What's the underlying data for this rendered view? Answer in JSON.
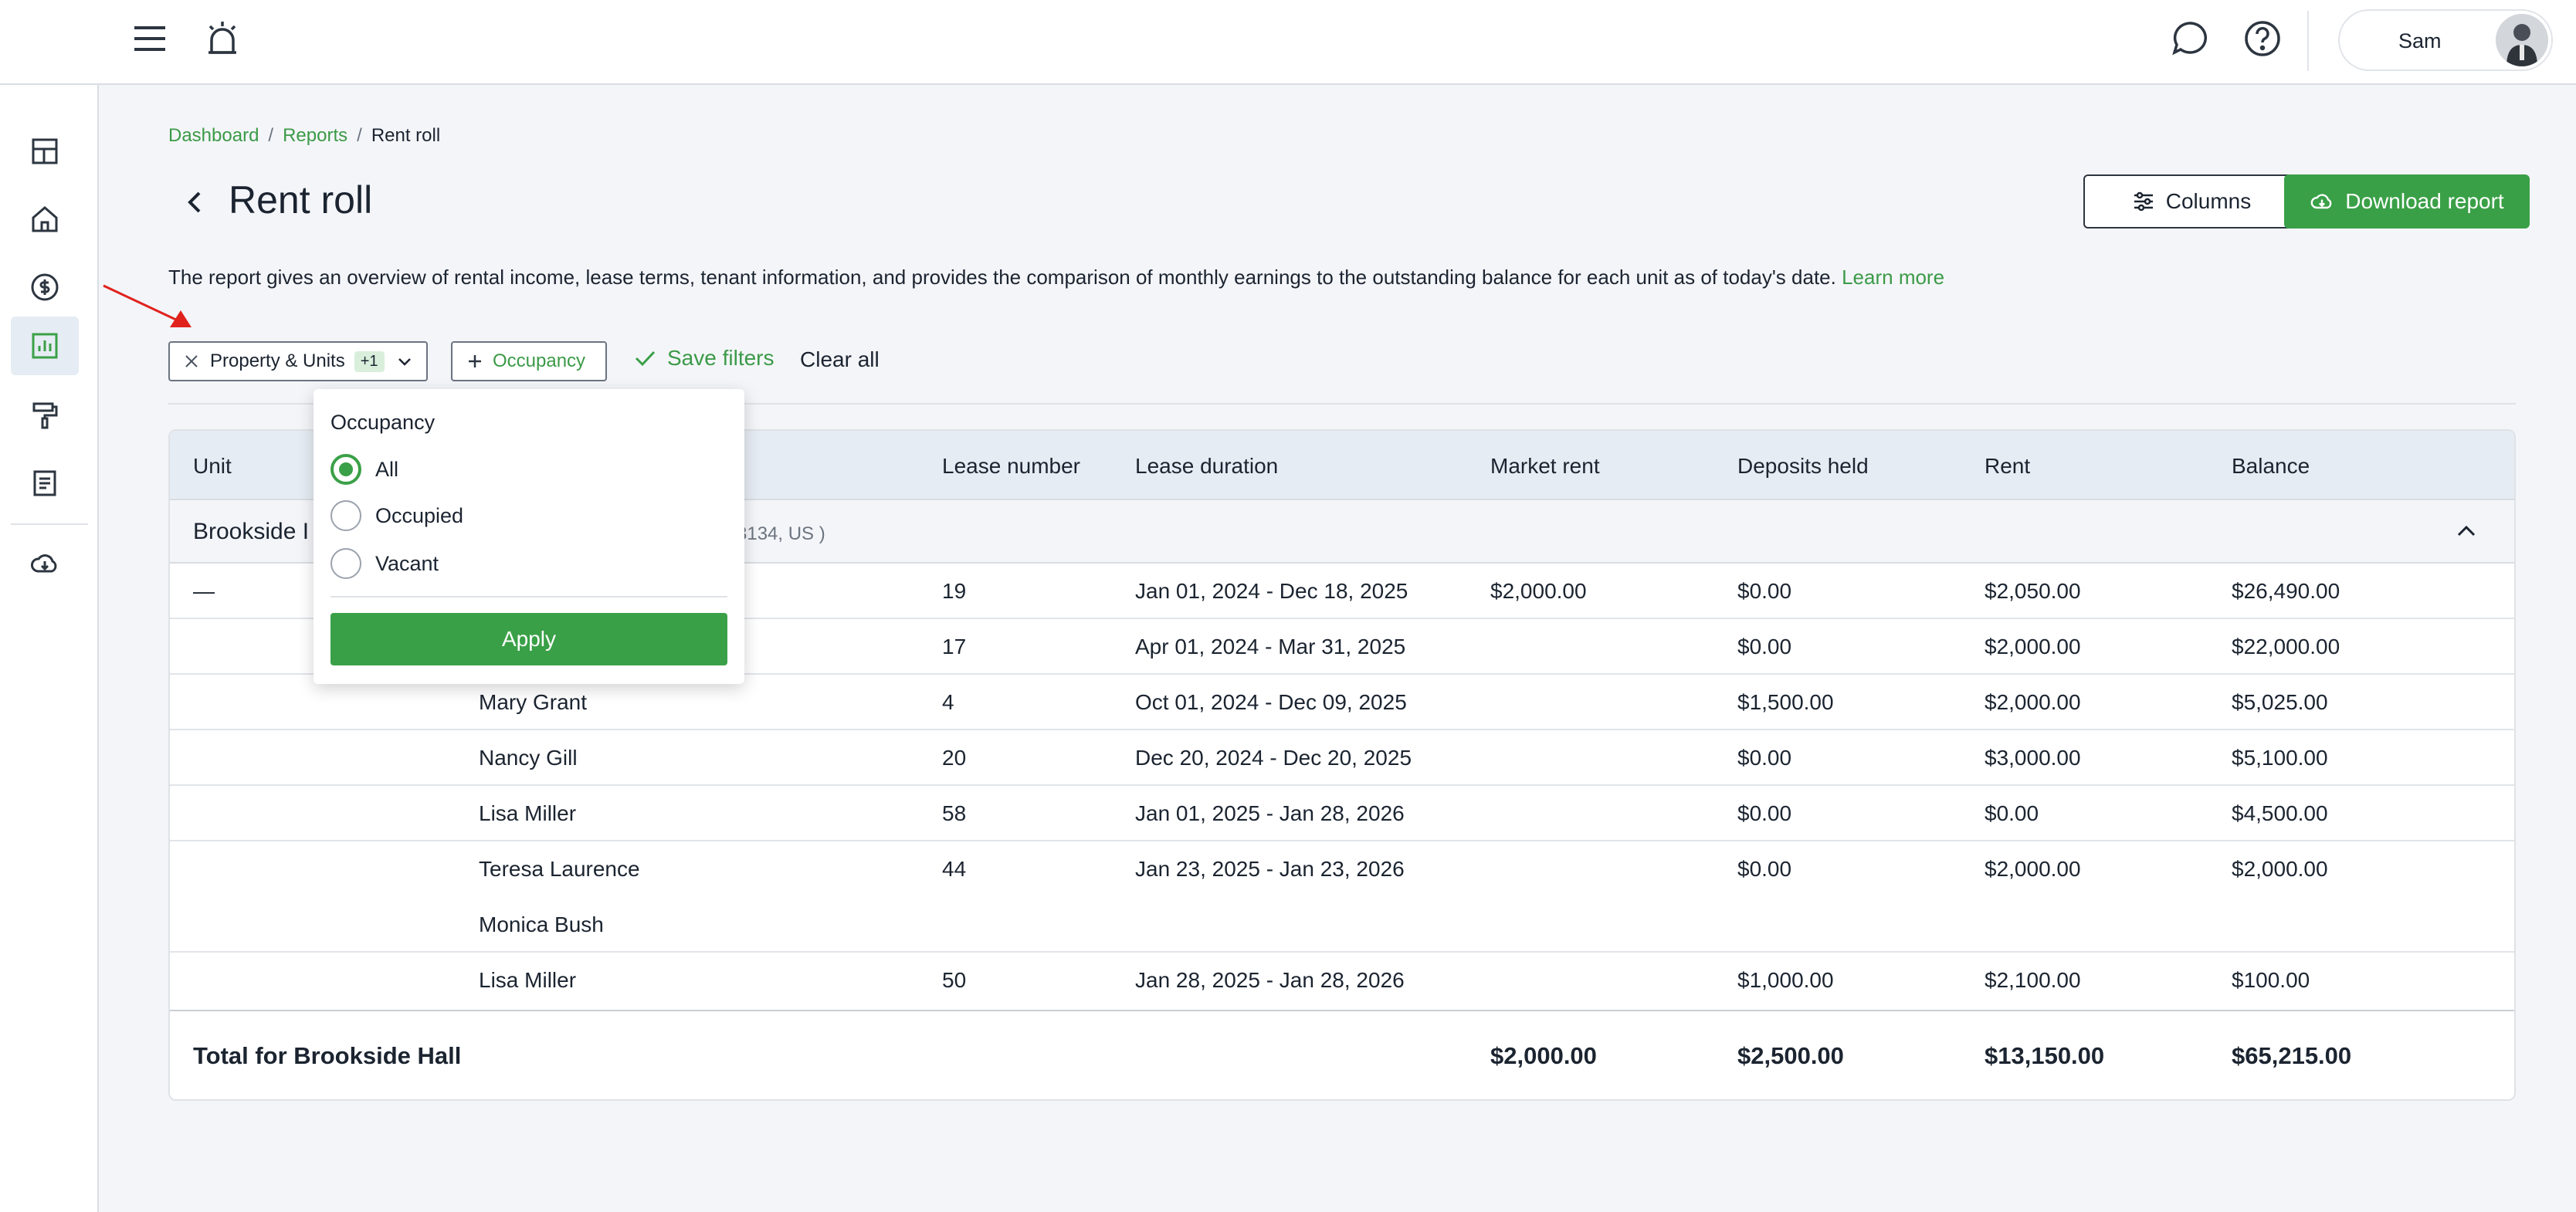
{
  "topbar": {
    "user_name": "Sam"
  },
  "breadcrumb": {
    "items": [
      "Dashboard",
      "Reports"
    ],
    "separator": "/",
    "current": "Rent roll"
  },
  "page": {
    "title": "Rent roll",
    "columns_label": "Columns",
    "download_label": "Download report",
    "description": "The report gives an overview of rental income, lease terms, tenant information, and provides the comparison of monthly earnings to the outstanding balance for each unit as of today's date.",
    "learn_more": "Learn more"
  },
  "filters": {
    "property_label": "Property & Units",
    "property_badge": "+1",
    "occupancy_label": "Occupancy",
    "save_label": "Save filters",
    "clear_label": "Clear all"
  },
  "dropdown": {
    "title": "Occupancy",
    "options": [
      "All",
      "Occupied",
      "Vacant"
    ],
    "selected": "All",
    "apply_label": "Apply"
  },
  "table": {
    "columns": {
      "unit": "Unit",
      "lease_number": "Lease number",
      "lease_duration": "Lease duration",
      "market_rent": "Market rent",
      "deposits_held": "Deposits held",
      "rent": "Rent",
      "balance": "Balance"
    },
    "group": {
      "name_visible": "Brookside I",
      "address_visible": "3134, US )"
    },
    "rows": [
      {
        "unit": "—",
        "tenant": "",
        "lease_number": "19",
        "lease_duration": "Jan 01, 2024 - Dec 18, 2025",
        "market_rent": "$2,000.00",
        "deposits_held": "$0.00",
        "rent": "$2,050.00",
        "balance": "$26,490.00"
      },
      {
        "unit": "",
        "tenant": "",
        "lease_number": "17",
        "lease_duration": "Apr 01, 2024 - Mar 31, 2025",
        "market_rent": "",
        "deposits_held": "$0.00",
        "rent": "$2,000.00",
        "balance": "$22,000.00"
      },
      {
        "unit": "",
        "tenant": "Mary Grant",
        "lease_number": "4",
        "lease_duration": "Oct 01, 2024 - Dec 09, 2025",
        "market_rent": "",
        "deposits_held": "$1,500.00",
        "rent": "$2,000.00",
        "balance": "$5,025.00"
      },
      {
        "unit": "",
        "tenant": "Nancy Gill",
        "lease_number": "20",
        "lease_duration": "Dec 20, 2024 - Dec 20, 2025",
        "market_rent": "",
        "deposits_held": "$0.00",
        "rent": "$3,000.00",
        "balance": "$5,100.00"
      },
      {
        "unit": "",
        "tenant": "Lisa Miller",
        "lease_number": "58",
        "lease_duration": "Jan 01, 2025 - Jan 28, 2026",
        "market_rent": "",
        "deposits_held": "$0.00",
        "rent": "$0.00",
        "balance": "$4,500.00"
      },
      {
        "unit": "",
        "tenant": "Teresa Laurence",
        "tenant2": "Monica Bush",
        "lease_number": "44",
        "lease_duration": "Jan 23, 2025 - Jan 23, 2026",
        "market_rent": "",
        "deposits_held": "$0.00",
        "rent": "$2,000.00",
        "balance": "$2,000.00"
      },
      {
        "unit": "",
        "tenant": "Lisa Miller",
        "lease_number": "50",
        "lease_duration": "Jan 28, 2025 - Jan 28, 2026",
        "market_rent": "",
        "deposits_held": "$1,000.00",
        "rent": "$2,100.00",
        "balance": "$100.00"
      }
    ],
    "total": {
      "label": "Total for Brookside Hall",
      "market_rent": "$2,000.00",
      "deposits_held": "$2,500.00",
      "rent": "$13,150.00",
      "balance": "$65,215.00"
    }
  },
  "colors": {
    "accent": "#3aa047",
    "link": "#3b9a47",
    "annotation_arrow": "#e0231d"
  }
}
